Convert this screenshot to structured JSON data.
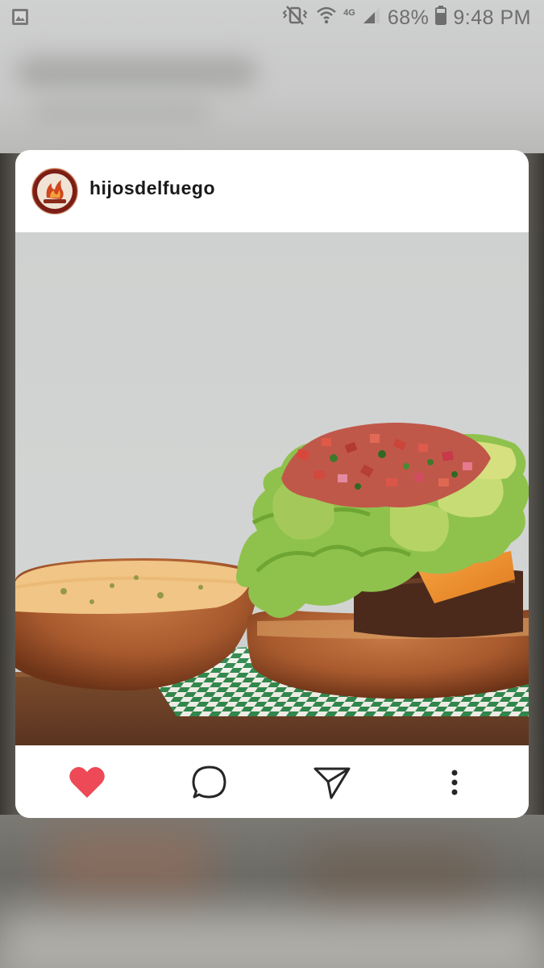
{
  "status_bar": {
    "battery": "68%",
    "time": "9:48 PM",
    "network": "4G",
    "icons": [
      "image-icon",
      "vibrate-mute-icon",
      "wifi-icon",
      "signal-icon",
      "battery-icon"
    ]
  },
  "post": {
    "username": "hijosdelfuego",
    "image": "burger-photo",
    "actions": [
      "heart-icon",
      "comment-icon",
      "share-icon",
      "more-icon"
    ],
    "liked": true
  },
  "colors": {
    "like": "#ed4956",
    "card": "#ffffff",
    "status_text": "#6e6e6e"
  }
}
